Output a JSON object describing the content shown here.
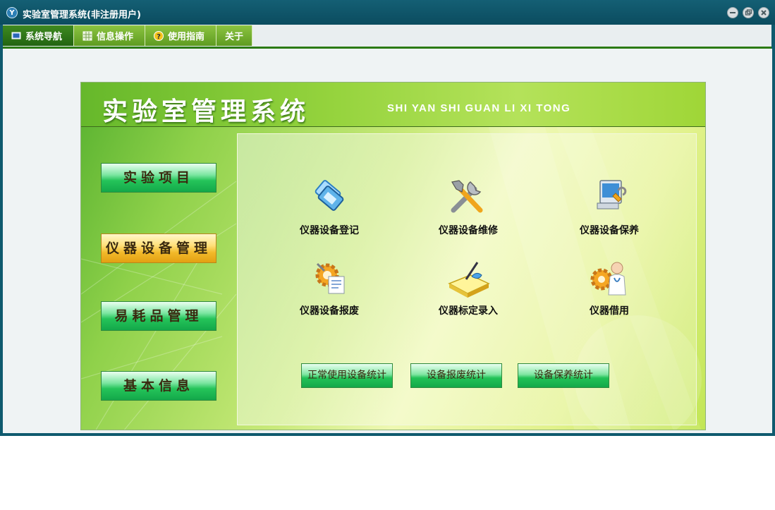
{
  "window": {
    "title": "实验室管理系统(非注册用户)",
    "app_icon_text": "Y"
  },
  "menu": {
    "tabs": [
      {
        "label": "系统导航",
        "icon": "monitor-icon",
        "active": true
      },
      {
        "label": "信息操作",
        "icon": "grid-icon",
        "active": false
      },
      {
        "label": "使用指南",
        "icon": "help-icon",
        "active": false
      },
      {
        "label": "关于",
        "icon": "",
        "active": false
      }
    ]
  },
  "panel": {
    "title": "实验室管理系统",
    "subtitle": "SHI YAN SHI GUAN LI XI TONG"
  },
  "sidebar": {
    "items": [
      {
        "label": "实验项目",
        "selected": false
      },
      {
        "label": "仪器设备管理",
        "selected": true
      },
      {
        "label": "易耗品管理",
        "selected": false
      },
      {
        "label": "基本信息",
        "selected": false
      }
    ]
  },
  "modules": [
    {
      "label": "仪器设备登记",
      "icon": "devices-icon"
    },
    {
      "label": "仪器设备维修",
      "icon": "tools-icon"
    },
    {
      "label": "仪器设备保养",
      "icon": "computer-maintenance-icon"
    },
    {
      "label": "仪器设备报废",
      "icon": "gear-document-icon"
    },
    {
      "label": "仪器标定录入",
      "icon": "book-pen-icon"
    },
    {
      "label": "仪器借用",
      "icon": "gear-doctor-icon"
    }
  ],
  "stats": {
    "buttons": [
      "正常使用设备统计",
      "设备报废统计",
      "设备保养统计"
    ]
  },
  "colors": {
    "title_bar": "#0f5a6e",
    "tab_green": "#5e9b21",
    "button_green": "#22c257",
    "selected_gold": "#f2b92a"
  }
}
